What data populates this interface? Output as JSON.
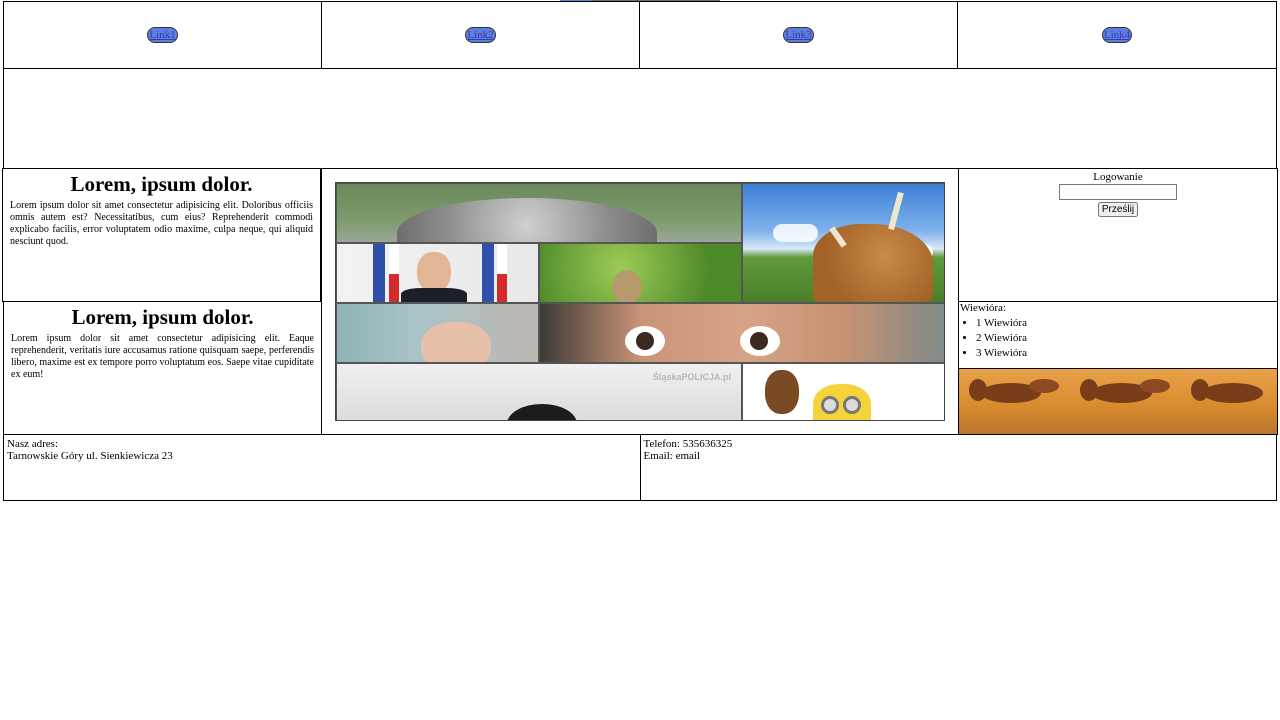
{
  "nav": {
    "links": [
      {
        "label": "Link1"
      },
      {
        "label": "Link2"
      },
      {
        "label": "Link3"
      },
      {
        "label": "Link4"
      }
    ]
  },
  "articles": [
    {
      "title": "Lorem, ipsum dolor.",
      "body": "Lorem ipsum dolor sit amet consectetur adipisicing elit. Doloribus officiis omnis autem est? Necessitatibus, cum eius? Reprehenderit commodi explicabo facilis, error voluptatem odio maxime, culpa neque, qui aliquid nesciunt quod."
    },
    {
      "title": "Lorem, ipsum dolor.",
      "body": "Lorem ipsum dolor sit amet consectetur adipisicing elit. Eaque reprehenderit, veritatis iure accusamus ratione quisquam saepe, perferendis libero, maxime est ex tempore porro voluptatum eos. Saepe vitae cupiditate ex eum!"
    }
  ],
  "login": {
    "title": "Logowanie",
    "input_value": "",
    "submit_label": "Prześlij"
  },
  "squirrels": {
    "title": "Wiewióra:",
    "items": [
      "1 Wiewióra",
      "2 Wiewióra",
      "3 Wiewióra"
    ]
  },
  "gallery": {
    "watermark": "ŚląskaPOLICJA.pl"
  },
  "footer": {
    "address_label": "Nasz adres:",
    "address_value": "Tarnowskie Góry ul. Sienkiewicza 23",
    "phone": "Telefon: 535636325",
    "email": "Email: email"
  },
  "colors": {
    "link_button_bg": "#5b7ee0",
    "link_text": "#3a3aa8",
    "border": "#000000"
  }
}
